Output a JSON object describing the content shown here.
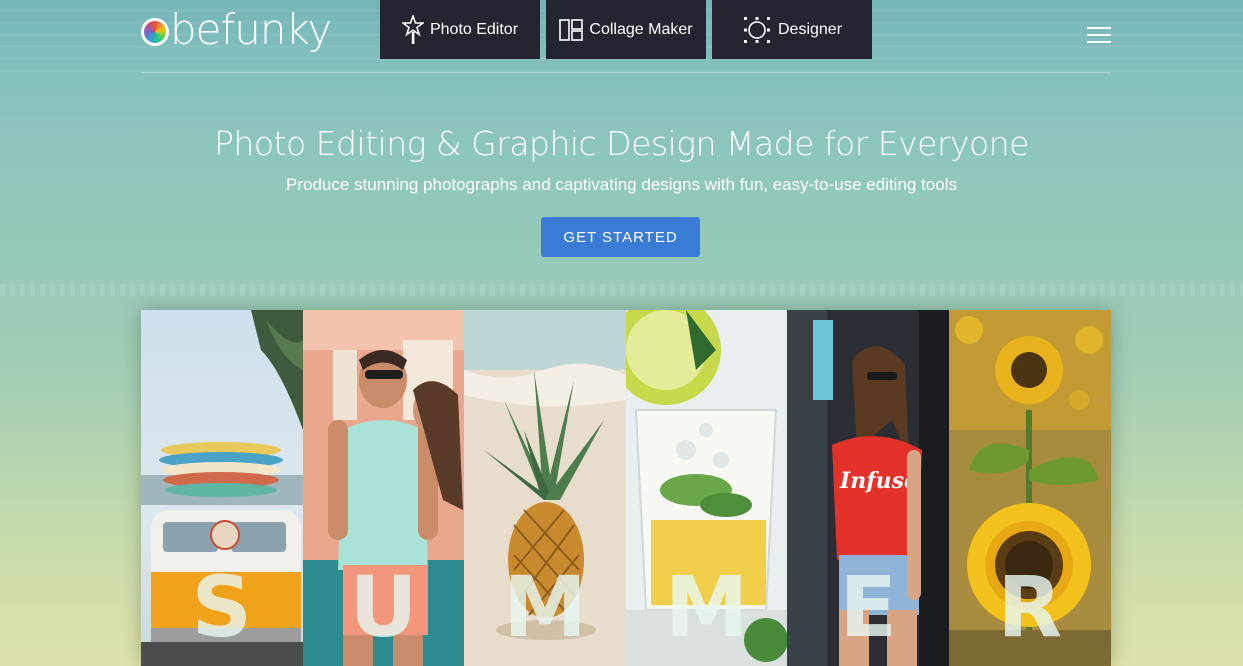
{
  "header": {
    "logo_text": "befunky",
    "nav": [
      {
        "label": "Photo Editor",
        "icon": "wand-star-icon"
      },
      {
        "label": "Collage Maker",
        "icon": "collage-grid-icon"
      },
      {
        "label": "Designer",
        "icon": "designer-frame-icon"
      }
    ],
    "menu_icon": "hamburger-menu-icon"
  },
  "hero": {
    "title": "Photo Editing & Graphic Design Made for Everyone",
    "subtitle": "Produce stunning photographs and captivating designs with fun, easy-to-use editing tools",
    "cta_label": "GET STARTED"
  },
  "showcase": {
    "panels": [
      {
        "letter": "S",
        "scene": "van-with-surfboards"
      },
      {
        "letter": "U",
        "scene": "couple-with-sunglasses"
      },
      {
        "letter": "M",
        "scene": "pineapple-on-beach"
      },
      {
        "letter": "M",
        "scene": "lemon-drink-glass"
      },
      {
        "letter": "E",
        "scene": "woman-red-tshirt",
        "shirt_text": "Infuse"
      },
      {
        "letter": "R",
        "scene": "sunflowers"
      }
    ]
  },
  "colors": {
    "nav_bg": "#242530",
    "cta_bg": "#3a7bd5"
  }
}
